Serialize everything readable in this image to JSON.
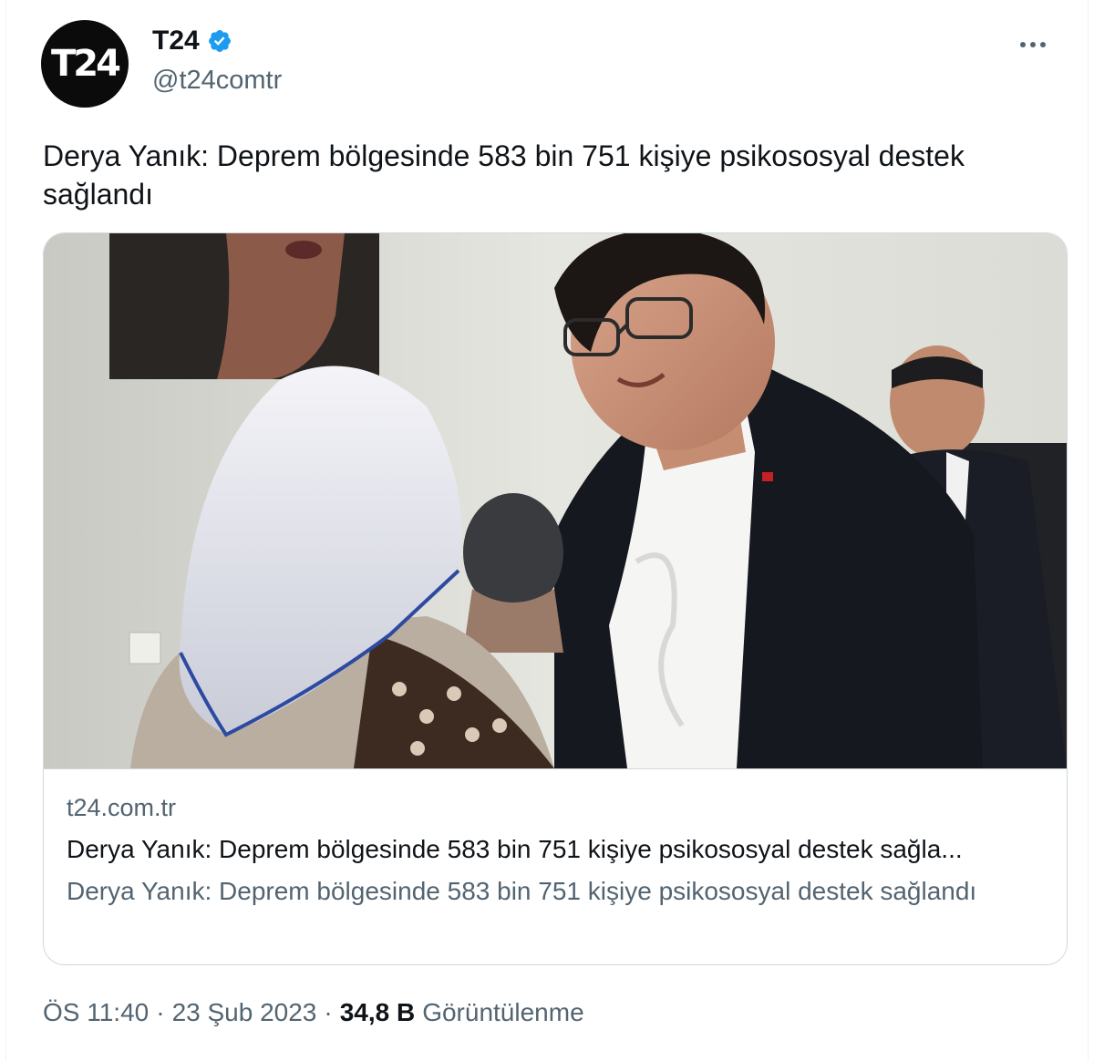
{
  "account": {
    "avatar_text": "T24",
    "display_name": "T24",
    "handle": "@t24comtr",
    "verified": true,
    "verified_color": "#1d9bf0"
  },
  "menu": {
    "icon": "more-horizontal-icon"
  },
  "tweet": {
    "text": "Derya Yanık: Deprem bölgesinde 583 bin 751 kişiye psikososyal destek sağlandı"
  },
  "card": {
    "domain": "t24.com.tr",
    "title": "Derya Yanık: Deprem bölgesinde 583 bin 751 kişiye psikososyal destek sağla...",
    "description": "Derya Yanık: Deprem bölgesinde 583 bin 751 kişiye psikososyal destek sağlandı"
  },
  "meta": {
    "time": "ÖS 11:40",
    "separator1": "·",
    "date": "23 Şub 2023",
    "separator2": "·",
    "views_count": "34,8 B",
    "views_label": "Görüntülenme"
  },
  "colors": {
    "text_primary": "#0f1419",
    "text_secondary": "#536471",
    "border": "#cfd9de",
    "verified": "#1d9bf0"
  }
}
